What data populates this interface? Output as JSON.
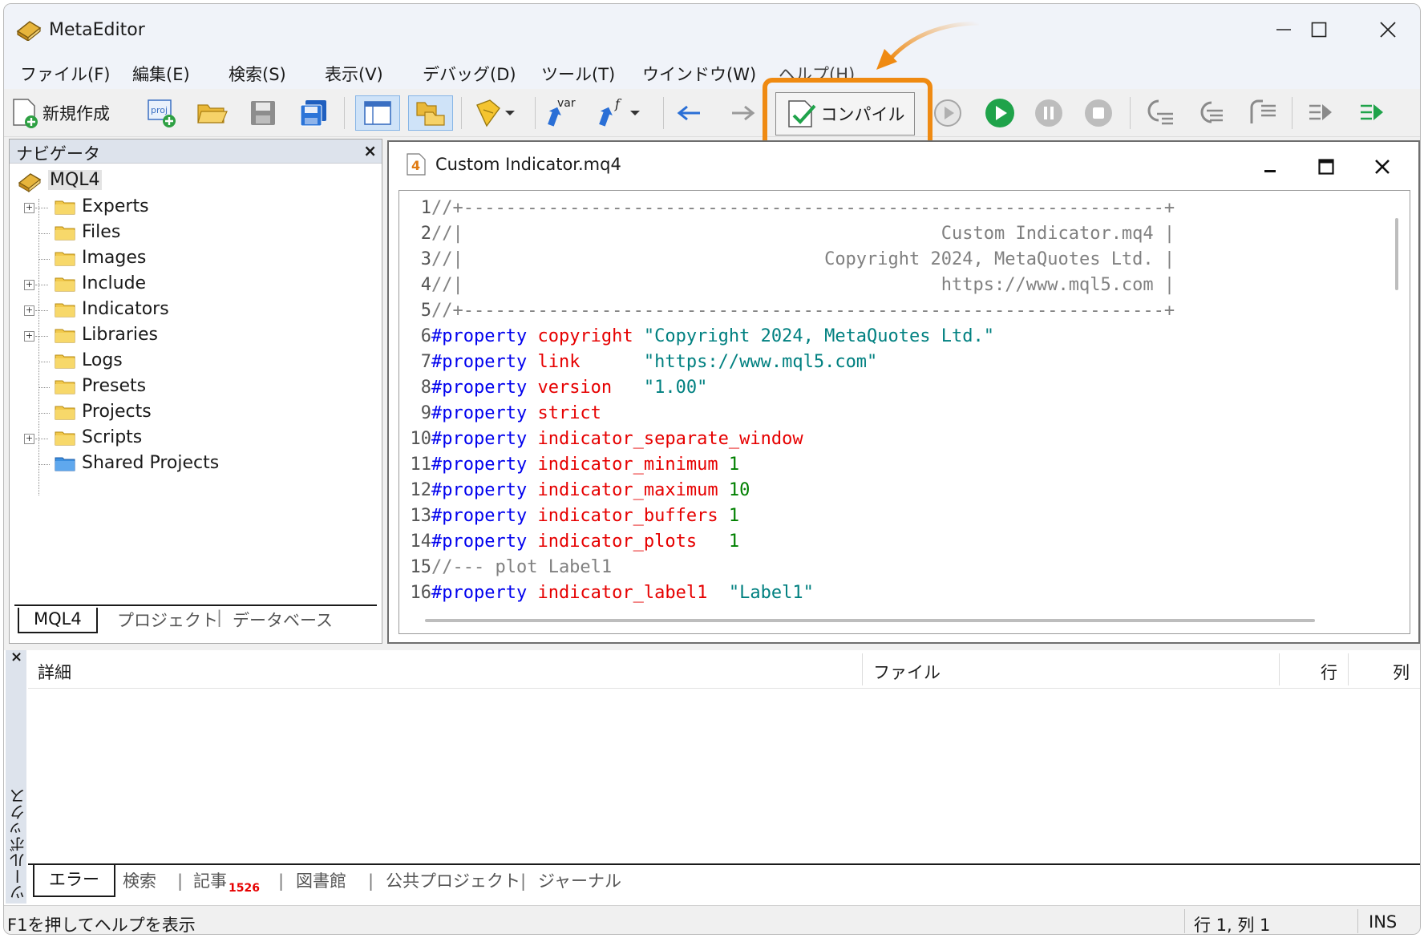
{
  "window": {
    "title": "MetaEditor"
  },
  "menu": [
    "ファイル(F)",
    "編集(E)",
    "検索(S)",
    "表示(V)",
    "デバッグ(D)",
    "ツール(T)",
    "ウインドウ(W)",
    "ヘルプ(H)"
  ],
  "toolbar": {
    "new_label": "新規作成",
    "var_label": "var",
    "compile_label": "コンパイル"
  },
  "navigator": {
    "title": "ナビゲータ",
    "root": "MQL4",
    "items": [
      "Experts",
      "Files",
      "Images",
      "Include",
      "Indicators",
      "Libraries",
      "Logs",
      "Presets",
      "Projects",
      "Scripts",
      "Shared Projects"
    ],
    "tabs": [
      "MQL4",
      "プロジェクト",
      "データベース"
    ]
  },
  "editor": {
    "tab_title": "Custom Indicator.mq4",
    "lines": [
      {
        "n": "1",
        "parts": [
          {
            "t": "//+------------------------------------------------------------------+",
            "c": "com"
          }
        ]
      },
      {
        "n": "2",
        "parts": [
          {
            "t": "//|                                             Custom Indicator.mq4 |",
            "c": "com"
          }
        ]
      },
      {
        "n": "3",
        "parts": [
          {
            "t": "//|                                  Copyright 2024, MetaQuotes Ltd. |",
            "c": "com"
          }
        ]
      },
      {
        "n": "4",
        "parts": [
          {
            "t": "//|                                             https://www.mql5.com |",
            "c": "com"
          }
        ]
      },
      {
        "n": "5",
        "parts": [
          {
            "t": "//+------------------------------------------------------------------+",
            "c": "com"
          }
        ]
      },
      {
        "n": "6",
        "parts": [
          {
            "t": "#property ",
            "c": "kw"
          },
          {
            "t": "copyright ",
            "c": "prop"
          },
          {
            "t": "\"Copyright 2024, MetaQuotes Ltd.\"",
            "c": "str"
          }
        ]
      },
      {
        "n": "7",
        "parts": [
          {
            "t": "#property ",
            "c": "kw"
          },
          {
            "t": "link      ",
            "c": "prop"
          },
          {
            "t": "\"https://www.mql5.com\"",
            "c": "str"
          }
        ]
      },
      {
        "n": "8",
        "parts": [
          {
            "t": "#property ",
            "c": "kw"
          },
          {
            "t": "version   ",
            "c": "prop"
          },
          {
            "t": "\"1.00\"",
            "c": "str"
          }
        ]
      },
      {
        "n": "9",
        "parts": [
          {
            "t": "#property ",
            "c": "kw"
          },
          {
            "t": "strict",
            "c": "prop"
          }
        ]
      },
      {
        "n": "10",
        "parts": [
          {
            "t": "#property ",
            "c": "kw"
          },
          {
            "t": "indicator_separate_window",
            "c": "prop"
          }
        ]
      },
      {
        "n": "11",
        "parts": [
          {
            "t": "#property ",
            "c": "kw"
          },
          {
            "t": "indicator_minimum ",
            "c": "prop"
          },
          {
            "t": "1",
            "c": "num"
          }
        ]
      },
      {
        "n": "12",
        "parts": [
          {
            "t": "#property ",
            "c": "kw"
          },
          {
            "t": "indicator_maximum ",
            "c": "prop"
          },
          {
            "t": "10",
            "c": "num"
          }
        ]
      },
      {
        "n": "13",
        "parts": [
          {
            "t": "#property ",
            "c": "kw"
          },
          {
            "t": "indicator_buffers ",
            "c": "prop"
          },
          {
            "t": "1",
            "c": "num"
          }
        ]
      },
      {
        "n": "14",
        "parts": [
          {
            "t": "#property ",
            "c": "kw"
          },
          {
            "t": "indicator_plots   ",
            "c": "prop"
          },
          {
            "t": "1",
            "c": "num"
          }
        ]
      },
      {
        "n": "15",
        "parts": [
          {
            "t": "//--- plot Label1",
            "c": "com"
          }
        ]
      },
      {
        "n": "16",
        "parts": [
          {
            "t": "#property ",
            "c": "kw"
          },
          {
            "t": "indicator_label1  ",
            "c": "prop"
          },
          {
            "t": "\"Label1\"",
            "c": "str"
          }
        ]
      }
    ]
  },
  "toolbox": {
    "side_label": "ツールボックス",
    "columns": [
      "詳細",
      "ファイル",
      "行",
      "列"
    ],
    "tabs": [
      "エラー",
      "検索",
      "記事",
      "図書館",
      "公共プロジェクト",
      "ジャーナル"
    ],
    "article_badge": "1526"
  },
  "status": {
    "help": "F1を押してヘルプを表示",
    "position": "行 1, 列 1",
    "mode": "INS"
  },
  "colors": {
    "highlight": "#ef8a12",
    "keyword": "#0000ee",
    "property": "#e60000",
    "string": "#008080",
    "number": "#008000",
    "comment": "#808080"
  }
}
